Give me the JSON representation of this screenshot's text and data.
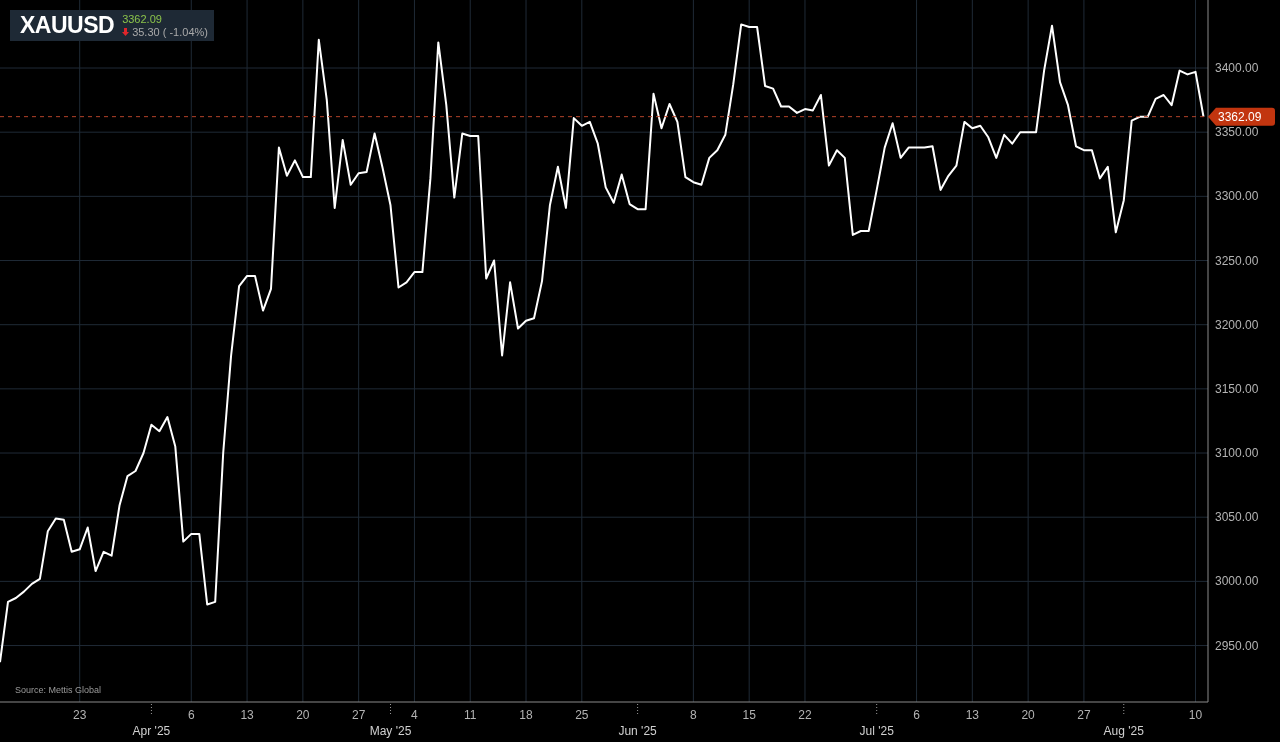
{
  "header": {
    "symbol": "XAUUSD",
    "price": "3362.09",
    "falling": true,
    "change": "35.30 ( -1.04%)"
  },
  "source": "Source: Mettis Global",
  "chart": {
    "period_labels": [
      "Apr '25",
      "May '25",
      "Jun '25",
      "Jul '25",
      "Aug '25"
    ],
    "chart_data": {
      "type": "line",
      "grid": true,
      "ylim": [
        2906,
        3453
      ],
      "categories": [
        null,
        null,
        null,
        null,
        null,
        null,
        null,
        null,
        null,
        null,
        "23",
        null,
        null,
        null,
        null,
        null,
        null,
        null,
        null,
        null,
        null,
        null,
        null,
        null,
        "6",
        null,
        null,
        null,
        null,
        null,
        null,
        "13",
        null,
        null,
        null,
        null,
        null,
        null,
        "20",
        null,
        null,
        null,
        null,
        null,
        null,
        "27",
        null,
        null,
        null,
        null,
        null,
        null,
        "4",
        null,
        null,
        null,
        null,
        null,
        null,
        "11",
        null,
        null,
        null,
        null,
        null,
        null,
        "18",
        null,
        null,
        null,
        null,
        null,
        null,
        "25",
        null,
        null,
        null,
        null,
        null,
        null,
        null,
        null,
        null,
        null,
        null,
        null,
        null,
        "8",
        null,
        null,
        null,
        null,
        null,
        null,
        "15",
        null,
        null,
        null,
        null,
        null,
        null,
        "22",
        null,
        null,
        null,
        null,
        null,
        null,
        null,
        null,
        null,
        null,
        null,
        null,
        null,
        "6",
        null,
        null,
        null,
        null,
        null,
        null,
        "13",
        null,
        null,
        null,
        null,
        null,
        null,
        "20",
        null,
        null,
        null,
        null,
        null,
        null,
        "27",
        null,
        null,
        null,
        null,
        null,
        null,
        null,
        null,
        null,
        null,
        null,
        null,
        null,
        "10",
        null
      ],
      "series": [
        {
          "color": "#ffffff",
          "values": [
            2937,
            2984,
            2987,
            2992,
            2998,
            3002,
            3039,
            3049,
            3048,
            3023,
            3025,
            3042,
            3008,
            3023,
            3020,
            3059,
            3082,
            3086,
            3100,
            3122,
            3117,
            3128,
            3105,
            3031,
            3037,
            3037,
            2982,
            2984,
            3100,
            3176,
            3230,
            3238,
            3238,
            3211,
            3228,
            3338,
            3316,
            3328,
            3315,
            3315,
            3422,
            3375,
            3291,
            3344,
            3309,
            3318,
            3319,
            3349,
            3322,
            3293,
            3229,
            3233,
            3241,
            3241,
            3314,
            3420,
            3371,
            3299,
            3349,
            3347,
            3347,
            3236,
            3250,
            3176,
            3233,
            3197,
            3203,
            3205,
            3234,
            3293,
            3323,
            3291,
            3361,
            3355,
            3358,
            3341,
            3307,
            3295,
            3317,
            3294,
            3290,
            3290,
            3380,
            3353,
            3372,
            3358,
            3315,
            3311,
            3309,
            3330,
            3336,
            3348,
            3387,
            3434,
            3432,
            3432,
            3386,
            3384,
            3370,
            3370,
            3365,
            3368,
            3367,
            3379,
            3324,
            3336,
            3330,
            3270,
            3273,
            3273,
            3305,
            3338,
            3357,
            3330,
            3338,
            3338,
            3338,
            3339,
            3305,
            3316,
            3324,
            3358,
            3353,
            3355,
            3346,
            3330,
            3348,
            3341,
            3350,
            3350,
            3350,
            3398,
            3433,
            3389,
            3371,
            3339,
            3336,
            3336,
            3314,
            3323,
            3272,
            3297,
            3359,
            3362,
            3362,
            3376,
            3379,
            3371,
            3398,
            3395,
            3397,
            3362
          ]
        }
      ],
      "yticks": [
        {
          "value": 2950,
          "label": "2950.00"
        },
        {
          "value": 3000,
          "label": "3000.00"
        },
        {
          "value": 3050,
          "label": "3050.00"
        },
        {
          "value": 3100,
          "label": "3100.00"
        },
        {
          "value": 3150,
          "label": "3150.00"
        },
        {
          "value": 3200,
          "label": "3200.00"
        },
        {
          "value": 3250,
          "label": "3250.00"
        },
        {
          "value": 3300,
          "label": "3300.00"
        },
        {
          "value": 3350,
          "label": "3350.00"
        },
        {
          "value": 3400,
          "label": "3400.00"
        }
      ],
      "ref_lines": [
        {
          "axis": "y",
          "value": 3362.09,
          "label": "3362.09"
        }
      ]
    }
  }
}
